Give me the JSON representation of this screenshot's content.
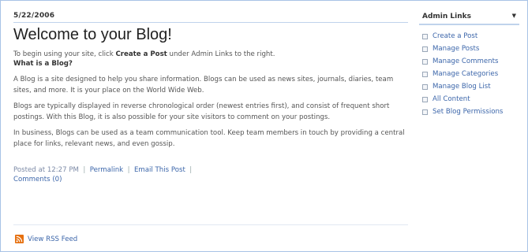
{
  "post": {
    "date": "5/22/2006",
    "title": "Welcome to your Blog!",
    "intro_before": "To begin using your site, click ",
    "intro_bold": "Create a Post",
    "intro_after": " under Admin Links to the right.",
    "question": "What is a Blog?",
    "para1": "A Blog is a site designed to help you share information. Blogs can be used as news sites, journals, diaries, team sites, and more. It is your place on the World Wide Web.",
    "para2": "Blogs are typically displayed in reverse chronological order (newest entries first), and consist of frequent short postings. With this Blog, it is also possible for your site visitors to comment on your postings.",
    "para3": "In business, Blogs can be used as a team communication tool. Keep team members in touch by providing a central place for links, relevant news, and even gossip.",
    "posted_at": "Posted at 12:27 PM",
    "permalink": "Permalink",
    "email_post": "Email This Post",
    "comments": "Comments (0)"
  },
  "rss": {
    "label": "View RSS Feed"
  },
  "sidebar": {
    "heading": "Admin Links",
    "links": [
      "Create a Post",
      "Manage Posts",
      "Manage Comments",
      "Manage Categories",
      "Manage Blog List",
      "All Content",
      "Set Blog Permissions"
    ]
  }
}
